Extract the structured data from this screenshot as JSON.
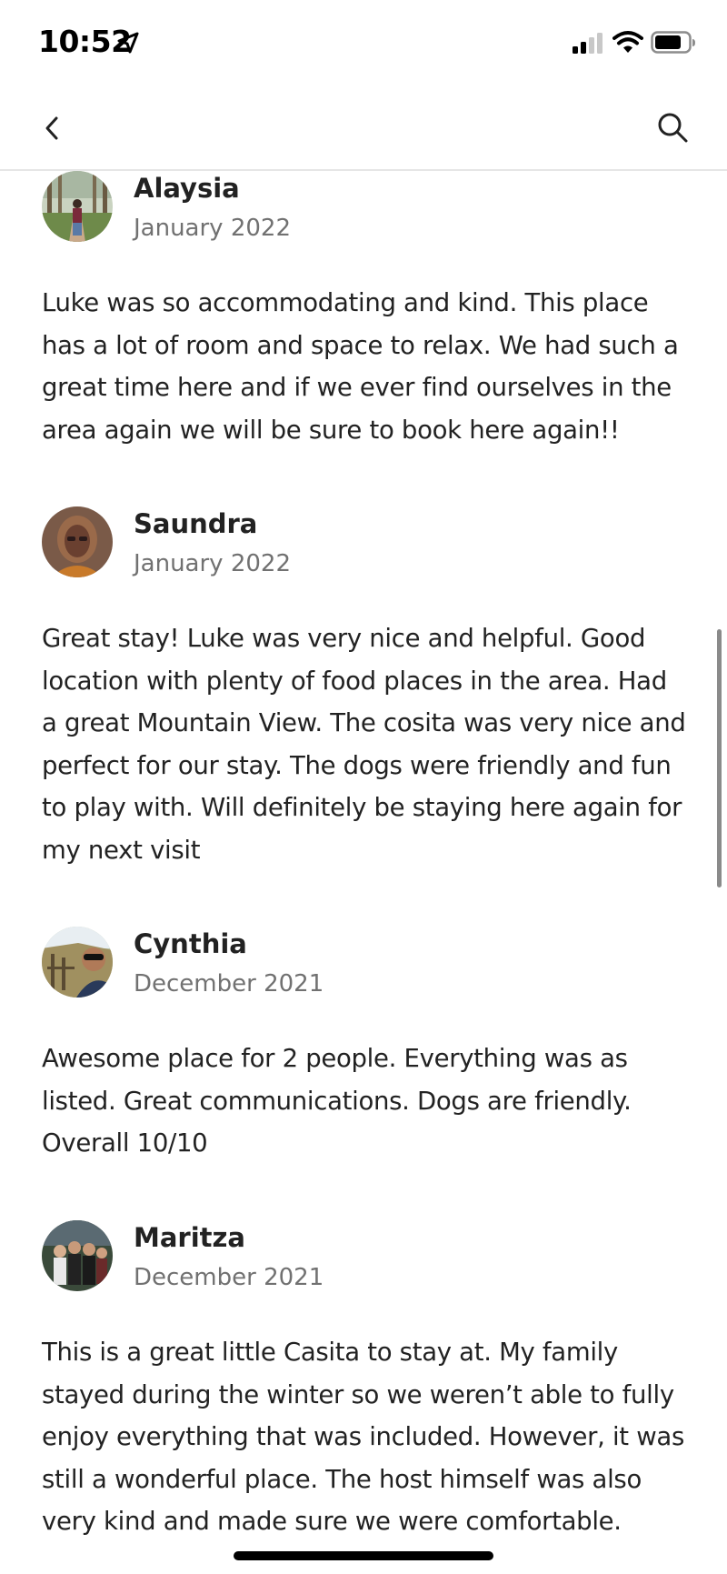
{
  "status_bar": {
    "time": "10:52"
  },
  "nav": {
    "back_icon": "chevron-left-icon",
    "search_icon": "search-icon"
  },
  "reviews": [
    {
      "name": "Alaysia",
      "date": "January 2022",
      "text": "Luke was so accommodating and kind. This place has a lot of room and space to relax. We had such a great time here and if we ever find ourselves in the area again we will be sure to book here again!!"
    },
    {
      "name": "Saundra",
      "date": "January 2022",
      "text": "Great stay! Luke was very nice and helpful. Good location with plenty of food places in the area. Had a great Mountain View. The cosita was very nice and perfect for our stay. The dogs were friendly and fun to play with. Will definitely be staying here again for my next visit"
    },
    {
      "name": "Cynthia",
      "date": "December 2021",
      "text": "Awesome place for 2 people. Everything was as listed. Great communications. Dogs are friendly. Overall 10/10"
    },
    {
      "name": "Maritza",
      "date": "December 2021",
      "text": "This is a great little Casita to stay at. My family stayed during the winter so we weren’t able to fully enjoy everything that was included. However, it was still a wonderful place. The host himself was also very kind and made sure we were comfortable."
    }
  ]
}
